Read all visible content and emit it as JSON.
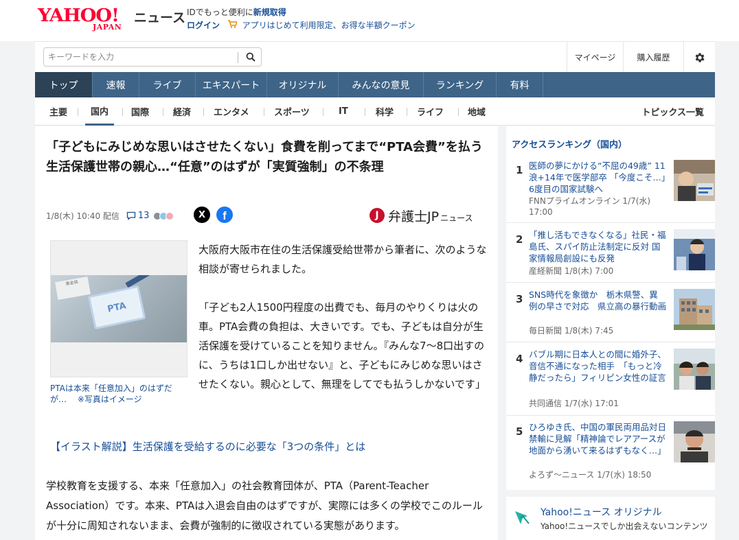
{
  "header": {
    "logo_yahoo": "YAHOO!",
    "logo_japan": "JAPAN",
    "logo_news": "ニュース",
    "link1_prefix": "IDでもっと便利に",
    "link1_bold": "新規取得",
    "login": "ログイン",
    "promo": "アプリはじめて利用限定、お得な半額クーポン"
  },
  "search": {
    "placeholder": "キーワードを入力",
    "mypage": "マイページ",
    "history": "購入履歴"
  },
  "main_nav": [
    "トップ",
    "速報",
    "ライブ",
    "エキスパート",
    "オリジナル",
    "みんなの意見",
    "ランキング",
    "有料"
  ],
  "sub_nav": [
    "主要",
    "国内",
    "国際",
    "経済",
    "エンタメ",
    "スポーツ",
    "IT",
    "科学",
    "ライフ",
    "地域"
  ],
  "topics_all": "トピックス一覧",
  "article": {
    "title": "「子どもにみじめな思いはさせたくない」食費を削ってまで“PTA会費”を払う生活保護世帯の親心…“任意”のはずが「実質強制」の不条理",
    "date": "1/8(木) 10:40 配信",
    "comments": "13",
    "share_x": "X",
    "share_fb": "f",
    "source_mark": "J",
    "source_name": "弁護士JP",
    "source_sub": "ニュース",
    "photo_label": "PTA",
    "photo_paper": "集金袋",
    "caption": "PTAは本来「任意加入」のはずだが…",
    "caption_note": "※写真はイメージ",
    "p1": "大阪府大阪市在住の生活保護受給世帯から筆者に、次のような相談が寄せられました。",
    "quote": "「子ども2人1500円程度の出費でも、毎月のやりくりは火の車。PTA会費の負担は、大きいです。でも、子どもは自分が生活保護を受けていることを知りません。『みんな7～8口出すのに、うちは1口しか出せない』と、子どもにみじめな思いはさせたくない。親心として、無理をしてでも払うしかないです」",
    "link": "【イラスト解説】生活保護を受給するのに必要な「3つの条件」とは",
    "p2": "学校教育を支援する、本来「任意加入」の社会教育団体が、PTA（Parent-Teacher Association）です。本来、PTAは入退会自由のはずですが、実際には多くの学校でこのルールが十分に周知されないまま、会費が強制的に徴収されている実態があります。"
  },
  "ranking": {
    "heading": "アクセスランキング（国内）",
    "items": [
      {
        "num": "1",
        "title": "医師の夢にかける“不屈の49歳” 11浪+14年で医学部卒 「今度こそ…」6度目の国家試験へ",
        "source": "FNNプライムオンライン 1/7(水) 17:00"
      },
      {
        "num": "2",
        "title": "「推し活もできなくなる」社民・福島氏、スパイ防止法制定に反対 国家情報局創設にも反発",
        "source": "産経新聞 1/8(木) 7:00"
      },
      {
        "num": "3",
        "title": "SNS時代を象徴か　栃木県警、異例の早さで対応　県立高の暴行動画",
        "source": "毎日新聞 1/8(木) 7:45"
      },
      {
        "num": "4",
        "title": "バブル期に日本人との間に婚外子、音信不通になった相手　「もっと冷静だったら」フィリピン女性の証言",
        "source": "共同通信 1/7(水) 17:01"
      },
      {
        "num": "5",
        "title": "ひろゆき氏、中国の軍民両用品対日禁輸に見解「精神論でレアアースが地面から湧いて来るはずもなく…」",
        "source": "よろず～ニュース 1/7(水) 18:50"
      }
    ]
  },
  "original": {
    "title": "Yahoo!ニュース オリジナル",
    "desc": "Yahoo!ニュースでしか出会えないコンテンツ"
  },
  "colors": {
    "brand_red": "#ff0033",
    "nav_blue": "#3e6487",
    "link_blue": "#174e96"
  }
}
